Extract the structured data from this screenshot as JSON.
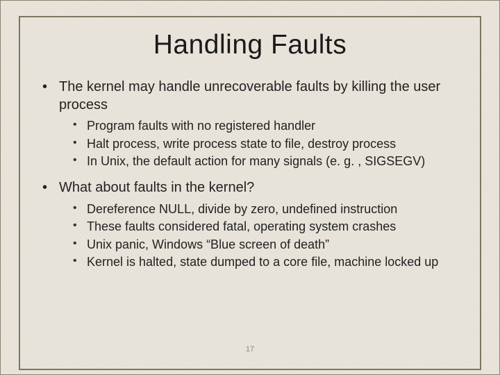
{
  "slide": {
    "title": "Handling Faults",
    "page_number": "17",
    "bullets": [
      {
        "text": "The kernel may handle unrecoverable faults by killing the user process",
        "children": [
          "Program faults with no registered handler",
          "Halt process, write process state to file, destroy process",
          "In Unix, the default action for many signals (e. g. , SIGSEGV)"
        ]
      },
      {
        "text": "What about faults in the kernel?",
        "children": [
          "Dereference NULL, divide by zero, undefined instruction",
          "These faults considered fatal, operating system crashes",
          "Unix panic, Windows “Blue screen of death”",
          "Kernel is halted, state dumped to a core file, machine locked up"
        ]
      }
    ]
  }
}
